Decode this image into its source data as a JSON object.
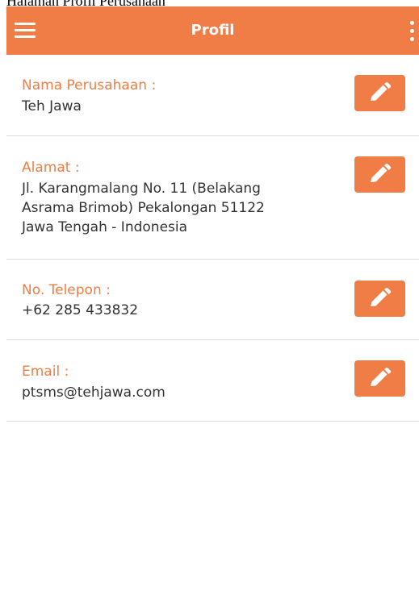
{
  "page_caption": "Halaman Profil Perusahaan",
  "appbar": {
    "title": "Profil",
    "menu_icon": "hamburger-menu-icon",
    "more_icon": "more-vertical-icon",
    "color": "#ef7d45"
  },
  "fields": [
    {
      "label": "Nama Perusahaan :",
      "value": "Teh Jawa",
      "edit_icon": "pencil-icon"
    },
    {
      "label": "Alamat :",
      "value": "Jl. Karangmalang No. 11 (Belakang\nAsrama Brimob) Pekalongan 51122\nJawa Tengah - Indonesia",
      "edit_icon": "pencil-icon"
    },
    {
      "label": "No. Telepon :",
      "value": "+62 285 433832",
      "edit_icon": "pencil-icon"
    },
    {
      "label": "Email :",
      "value": "ptsms@tehjawa.com",
      "edit_icon": "pencil-icon"
    }
  ]
}
